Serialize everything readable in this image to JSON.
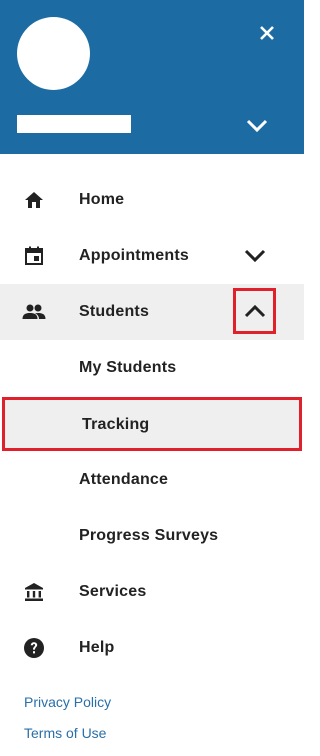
{
  "nav": {
    "home": "Home",
    "appointments": "Appointments",
    "students": "Students",
    "students_sub": [
      "My Students",
      "Tracking",
      "Attendance",
      "Progress Surveys"
    ],
    "services": "Services",
    "help": "Help"
  },
  "footer": {
    "privacy": "Privacy Policy",
    "terms": "Terms of Use"
  },
  "colors": {
    "header_bg": "#1c6ca3",
    "highlight_border": "#e0202a",
    "active_bg": "#efefef",
    "link": "#2a6fa8"
  },
  "icons": {
    "close": "close-icon",
    "header_chevron": "chevron-down-icon",
    "home": "home-icon",
    "appointments": "calendar-icon",
    "students": "people-icon",
    "services": "bank-icon",
    "help": "help-circle-icon"
  }
}
